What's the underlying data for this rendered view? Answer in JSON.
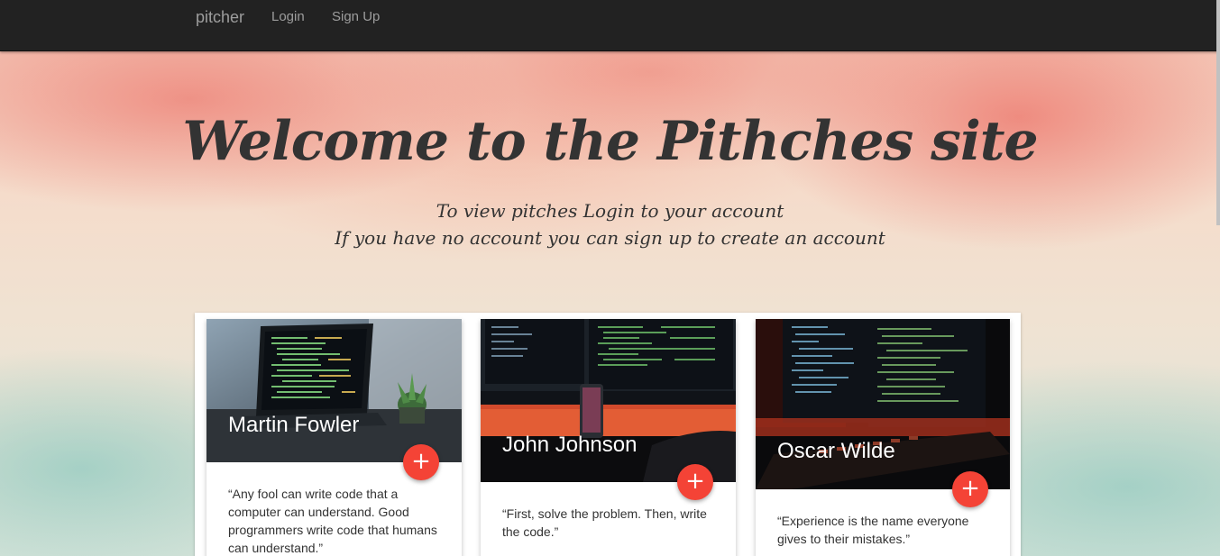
{
  "navbar": {
    "brand": "pitcher",
    "links": [
      "Login",
      "Sign Up"
    ]
  },
  "hero": {
    "title": "Welcome to the Pithches site",
    "subtitle_line1": "To view pitches Login to your account",
    "subtitle_line2": "If you have no account you can sign up to create an account"
  },
  "cards": [
    {
      "name": "Martin Fowler",
      "quote": "“Any fool can write code that a computer can understand. Good programmers write code that humans can understand.”",
      "action_icon": "plus-icon"
    },
    {
      "name": "John Johnson",
      "quote": "“First, solve the problem. Then, write the code.”",
      "action_icon": "plus-icon"
    },
    {
      "name": "Oscar Wilde",
      "quote": "“Experience is the name everyone gives to their mistakes.”",
      "action_icon": "plus-icon"
    }
  ],
  "colors": {
    "navbar": "#222222",
    "fab": "#f44336",
    "text": "#333333"
  }
}
